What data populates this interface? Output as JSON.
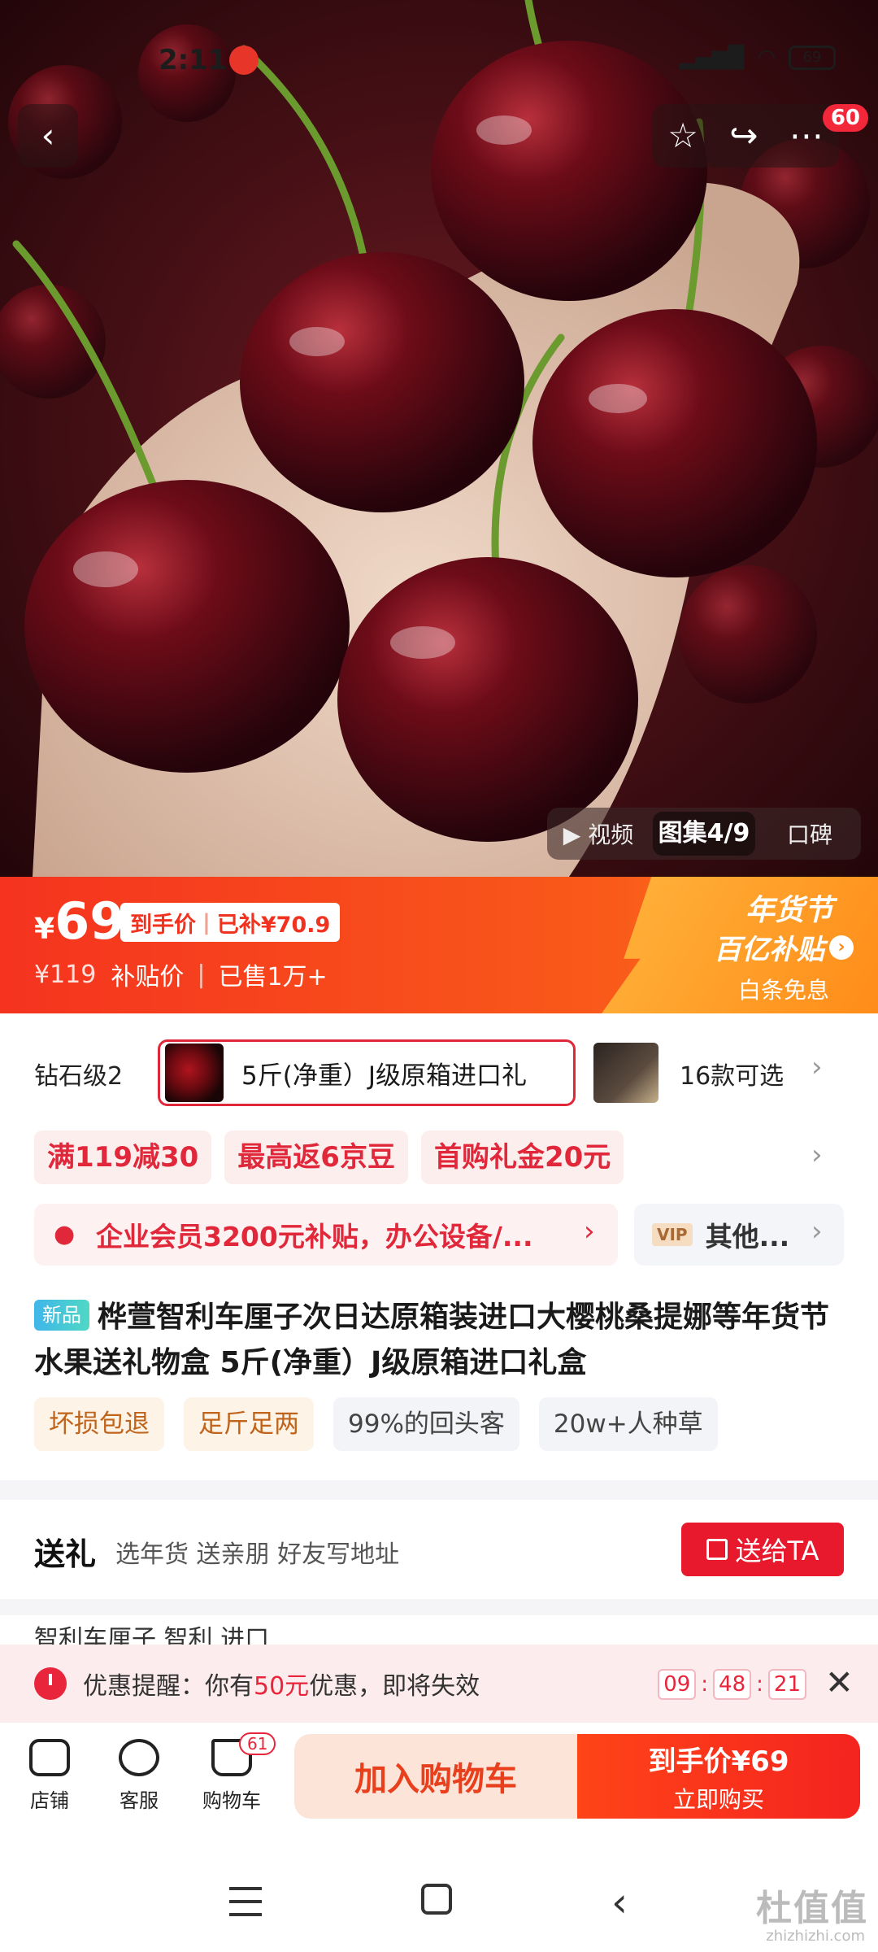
{
  "status": {
    "time": "2:11",
    "battery": "69"
  },
  "nav": {
    "cart_badge": "60"
  },
  "media_tabs": [
    "视频",
    "图集4/9",
    "口碑"
  ],
  "price": {
    "symbol": "¥",
    "value": "69",
    "tag_label": "到手价",
    "tag_subsidy": "已补¥70.9",
    "original": "¥119",
    "sub_label": "补贴价",
    "sold": "已售1万+"
  },
  "festival": {
    "title": "年货节",
    "subtitle": "百亿补贴",
    "note": "白条免息"
  },
  "spec": {
    "prev_label": "钻石级2",
    "selected_label": "5斤(净重）J级原箱进口礼",
    "count_label": "16款可选"
  },
  "coupons": [
    "满119减30",
    "最高返6京豆",
    "首购礼金20元"
  ],
  "member": {
    "text": "企业会员3200元补贴，办公设备/...",
    "vip_label": "VIP",
    "other_label": "其他..."
  },
  "product": {
    "new_badge": "新品",
    "title": "桦萱智利车厘子次日达原箱装进口大樱桃桑提娜等年货节水果送礼物盒 5斤(净重）J级原箱进口礼盒"
  },
  "tags": [
    "坏损包退",
    "足斤足两",
    "99%的回头客",
    "20w+人种草"
  ],
  "gift": {
    "title": "送礼",
    "subtitle": "选年货 送亲朋 好友写地址",
    "button": "送给TA"
  },
  "peek": "智利车厘子          智利                    进口",
  "reminder": {
    "prefix": "优惠提醒：你有",
    "amount": "50元",
    "suffix": "优惠，即将失效",
    "timer": [
      "09",
      "48",
      "21"
    ]
  },
  "bottom": {
    "shop": "店铺",
    "service": "客服",
    "cart": "购物车",
    "cart_badge": "61",
    "add_cart": "加入购物车",
    "buy_line1": "到手价¥69",
    "buy_line2": "立即购买"
  },
  "watermark": {
    "main": "杜值值",
    "sub": "zhizhizhi.com"
  },
  "colors": {
    "accent": "#f5331f",
    "festival": "#ff8c18",
    "buy": "#f4231f"
  }
}
